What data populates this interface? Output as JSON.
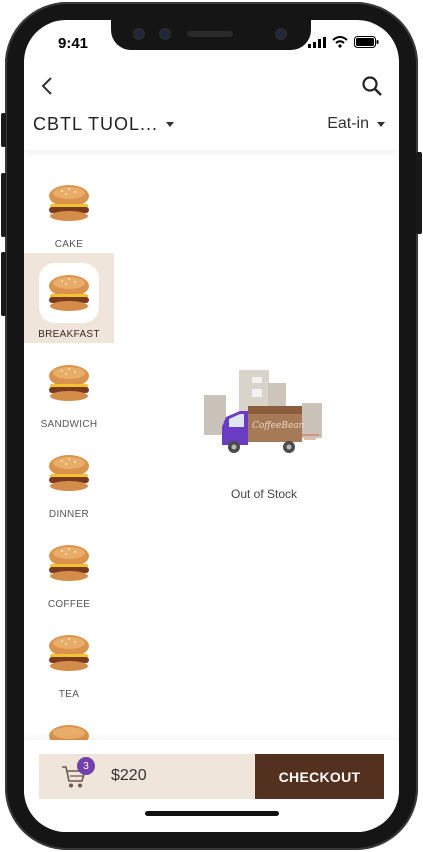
{
  "status_bar": {
    "time": "9:41"
  },
  "header": {
    "store_name": "CBTL TUOL...",
    "order_mode": "Eat-in"
  },
  "categories": [
    {
      "label": "CAKE",
      "selected": false
    },
    {
      "label": "BREAKFAST",
      "selected": true
    },
    {
      "label": "SANDWICH",
      "selected": false
    },
    {
      "label": "DINNER",
      "selected": false
    },
    {
      "label": "COFFEE",
      "selected": false
    },
    {
      "label": "TEA",
      "selected": false
    }
  ],
  "empty_state": {
    "message": "Out of Stock",
    "truck_text": "CoffeeBean"
  },
  "cart": {
    "count": "3",
    "total": "$220"
  },
  "checkout_label": "CHECKOUT",
  "colors": {
    "accent_dark": "#54301f",
    "accent_light": "#efe5da",
    "badge": "#7342a8"
  }
}
